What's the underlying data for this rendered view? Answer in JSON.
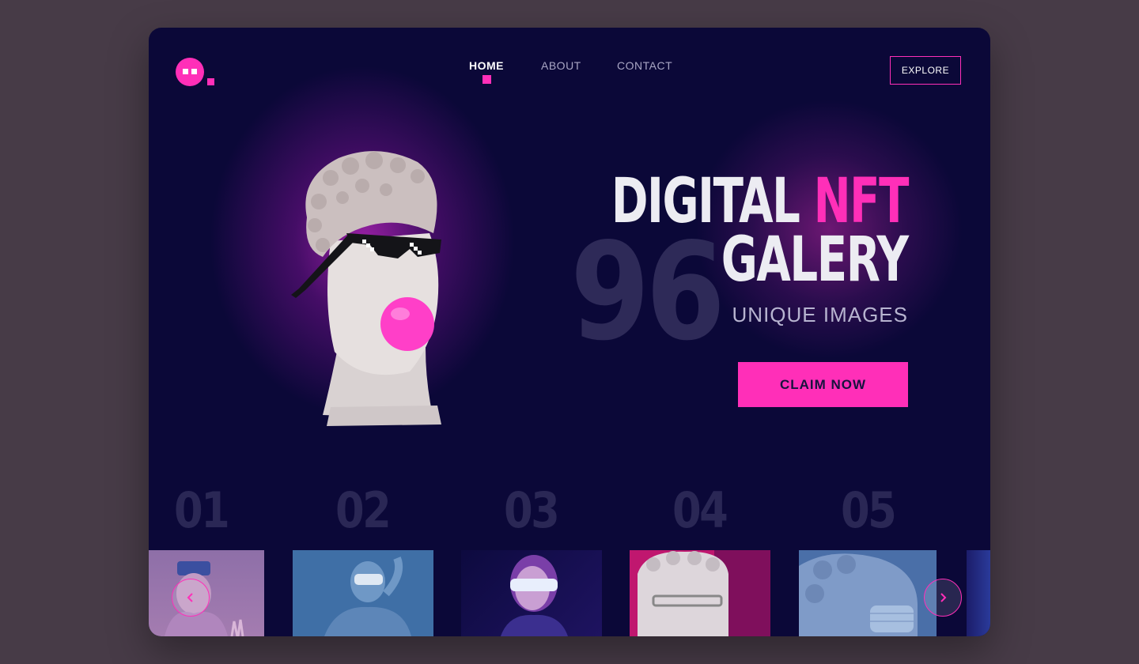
{
  "nav": {
    "items": [
      {
        "label": "HOME",
        "active": true
      },
      {
        "label": "ABOUT",
        "active": false
      },
      {
        "label": "CONTACT",
        "active": false
      }
    ],
    "explore_label": "EXPLORE"
  },
  "hero": {
    "title_white": "DIGITAL",
    "title_accent": "NFT",
    "title_line2": "GALERY",
    "count": "96",
    "subtitle": "UNIQUE IMAGES",
    "cta_label": "CLAIM  NOW"
  },
  "gallery": {
    "numbers": [
      "01",
      "02",
      "03",
      "04",
      "05"
    ],
    "prev_icon": "chevron-left-icon",
    "next_icon": "chevron-right-icon"
  },
  "colors": {
    "background": "#0b0838",
    "accent": "#ff2fb8",
    "outer": "#473b47"
  }
}
